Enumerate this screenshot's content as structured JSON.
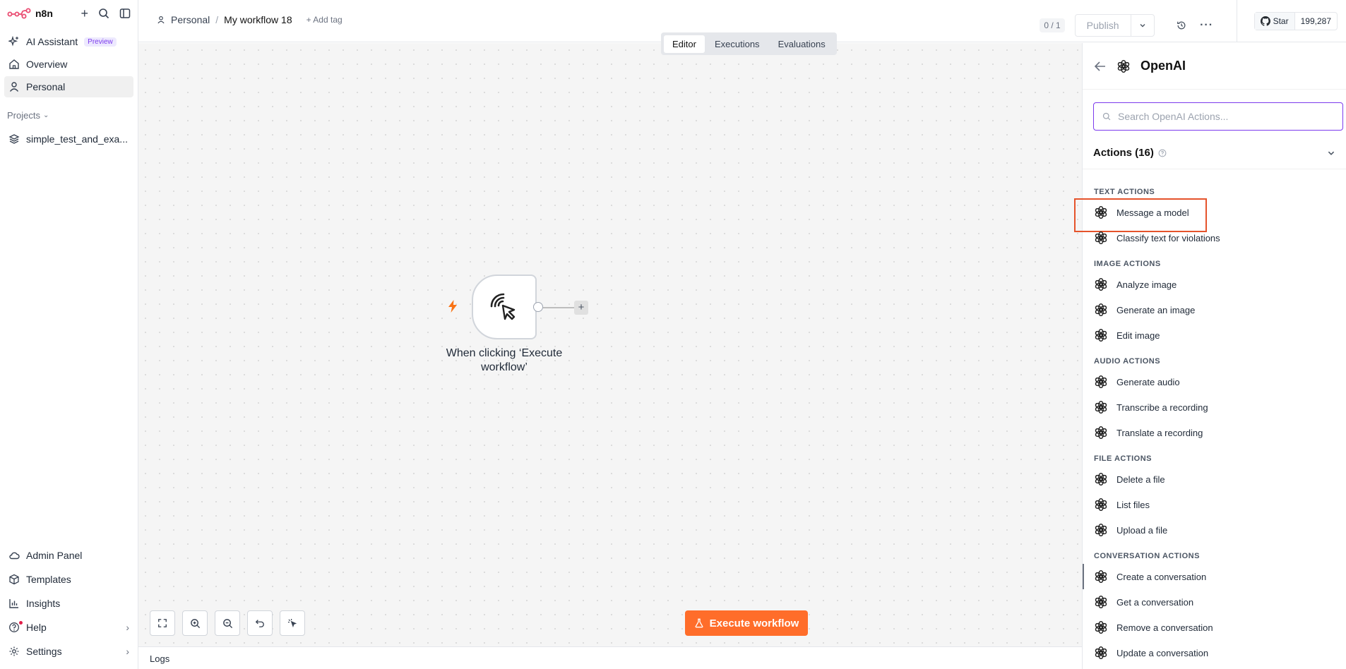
{
  "sidebar": {
    "brand": "n8n",
    "items": [
      {
        "label": "AI Assistant",
        "badge": "Preview"
      },
      {
        "label": "Overview"
      },
      {
        "label": "Personal"
      }
    ],
    "projects_label": "Projects",
    "projects": [
      {
        "label": "simple_test_and_exa..."
      }
    ],
    "bottom": [
      {
        "label": "Admin Panel"
      },
      {
        "label": "Templates"
      },
      {
        "label": "Insights"
      },
      {
        "label": "Help"
      },
      {
        "label": "Settings"
      }
    ]
  },
  "header": {
    "breadcrumb_project": "Personal",
    "breadcrumb_sep": "/",
    "workflow_name": "My workflow 18",
    "add_tag": "+ Add tag",
    "counter": "0 / 1",
    "publish": "Publish",
    "github_star": "Star",
    "github_count": "199,287"
  },
  "tabs": [
    {
      "label": "Editor",
      "active": true
    },
    {
      "label": "Executions"
    },
    {
      "label": "Evaluations"
    }
  ],
  "canvas": {
    "node_label": "When clicking ‘Execute workflow’",
    "execute_button": "Execute workflow",
    "logs_label": "Logs"
  },
  "panel": {
    "title": "OpenAI",
    "search_placeholder": "Search OpenAI Actions...",
    "actions_header": "Actions (16)",
    "groups": [
      {
        "title": "TEXT ACTIONS",
        "actions": [
          "Message a model",
          "Classify text for violations"
        ]
      },
      {
        "title": "IMAGE ACTIONS",
        "actions": [
          "Analyze image",
          "Generate an image",
          "Edit image"
        ]
      },
      {
        "title": "AUDIO ACTIONS",
        "actions": [
          "Generate audio",
          "Transcribe a recording",
          "Translate a recording"
        ]
      },
      {
        "title": "FILE ACTIONS",
        "actions": [
          "Delete a file",
          "List files",
          "Upload a file"
        ]
      },
      {
        "title": "CONVERSATION ACTIONS",
        "actions": [
          "Create a conversation",
          "Get a conversation",
          "Remove a conversation",
          "Update a conversation"
        ]
      }
    ]
  },
  "colors": {
    "accent": "#ff6d2a",
    "focus": "#7c3aed",
    "highlight_box": "#e5532b"
  }
}
